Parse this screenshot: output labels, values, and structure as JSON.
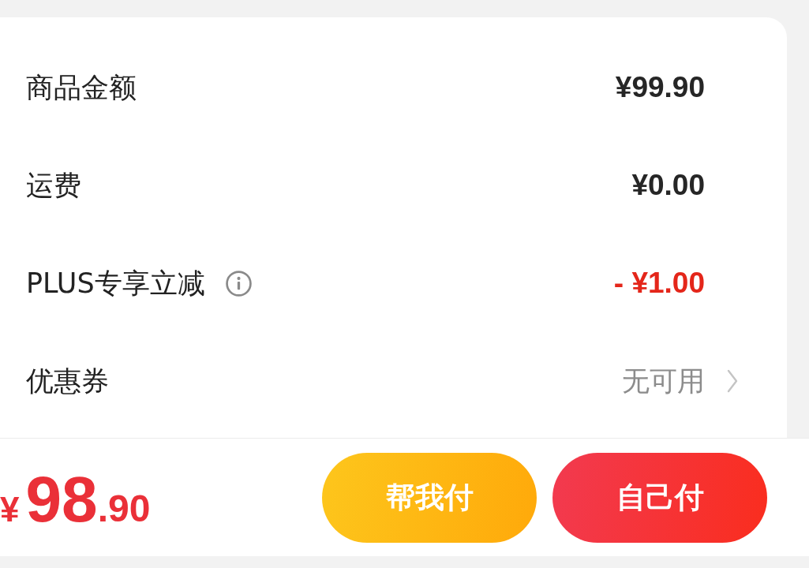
{
  "summary_rows": [
    {
      "kind": "amount",
      "label": "商品金额",
      "has_info": false,
      "value": "¥99.90"
    },
    {
      "kind": "amount",
      "label": "运费",
      "has_info": false,
      "value": "¥0.00"
    },
    {
      "kind": "discount",
      "label": "PLUS专享立减",
      "has_info": true,
      "value": "- ¥1.00"
    },
    {
      "kind": "link",
      "label": "优惠券",
      "has_info": false,
      "value": "无可用"
    }
  ],
  "checkout_bar": {
    "total": {
      "currency": "¥",
      "integer": "98",
      "decimal": ".90"
    },
    "buttons": [
      {
        "kind": "secondary",
        "label": "帮我付"
      },
      {
        "kind": "primary",
        "label": "自己付"
      }
    ]
  }
}
